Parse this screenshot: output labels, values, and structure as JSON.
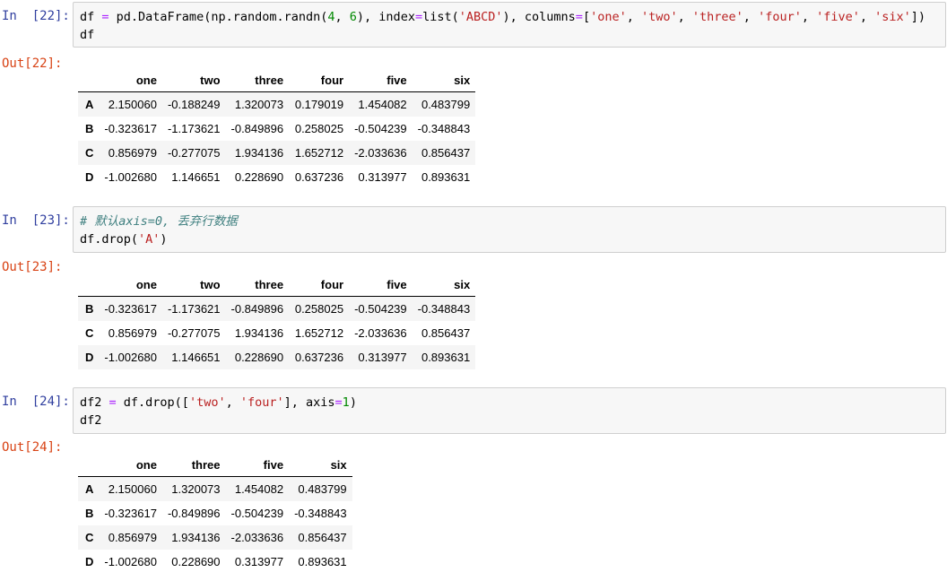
{
  "cells": [
    {
      "in_prompt": "In  [22]:",
      "code_lines": [
        [
          {
            "t": "df ",
            "k": ""
          },
          {
            "t": "=",
            "k": "o"
          },
          {
            "t": " pd.DataFrame(np.random.randn(",
            "k": ""
          },
          {
            "t": "4",
            "k": "n"
          },
          {
            "t": ", ",
            "k": ""
          },
          {
            "t": "6",
            "k": "n"
          },
          {
            "t": "), index",
            "k": ""
          },
          {
            "t": "=",
            "k": "o"
          },
          {
            "t": "list(",
            "k": ""
          },
          {
            "t": "'ABCD'",
            "k": "s"
          },
          {
            "t": "), columns",
            "k": ""
          },
          {
            "t": "=",
            "k": "o"
          },
          {
            "t": "[",
            "k": ""
          },
          {
            "t": "'one'",
            "k": "s"
          },
          {
            "t": ", ",
            "k": ""
          },
          {
            "t": "'two'",
            "k": "s"
          },
          {
            "t": ", ",
            "k": ""
          },
          {
            "t": "'three'",
            "k": "s"
          },
          {
            "t": ", ",
            "k": ""
          },
          {
            "t": "'four'",
            "k": "s"
          },
          {
            "t": ", ",
            "k": ""
          },
          {
            "t": "'five'",
            "k": "s"
          },
          {
            "t": ", ",
            "k": ""
          },
          {
            "t": "'six'",
            "k": "s"
          },
          {
            "t": "])",
            "k": ""
          }
        ],
        [
          {
            "t": "df",
            "k": ""
          }
        ]
      ],
      "out_prompt": "Out[22]:",
      "table": {
        "columns": [
          "one",
          "two",
          "three",
          "four",
          "five",
          "six"
        ],
        "rows": [
          {
            "index": "A",
            "values": [
              "2.150060",
              "-0.188249",
              "1.320073",
              "0.179019",
              "1.454082",
              "0.483799"
            ]
          },
          {
            "index": "B",
            "values": [
              "-0.323617",
              "-1.173621",
              "-0.849896",
              "0.258025",
              "-0.504239",
              "-0.348843"
            ]
          },
          {
            "index": "C",
            "values": [
              "0.856979",
              "-0.277075",
              "1.934136",
              "1.652712",
              "-2.033636",
              "0.856437"
            ]
          },
          {
            "index": "D",
            "values": [
              "-1.002680",
              "1.146651",
              "0.228690",
              "0.637236",
              "0.313977",
              "0.893631"
            ]
          }
        ]
      }
    },
    {
      "in_prompt": "In  [23]:",
      "code_lines": [
        [
          {
            "t": "# 默认axis=0, 丢弃行数据",
            "k": "c"
          }
        ],
        [
          {
            "t": "df.drop(",
            "k": ""
          },
          {
            "t": "'A'",
            "k": "s"
          },
          {
            "t": ")",
            "k": ""
          }
        ]
      ],
      "out_prompt": "Out[23]:",
      "table": {
        "columns": [
          "one",
          "two",
          "three",
          "four",
          "five",
          "six"
        ],
        "rows": [
          {
            "index": "B",
            "values": [
              "-0.323617",
              "-1.173621",
              "-0.849896",
              "0.258025",
              "-0.504239",
              "-0.348843"
            ]
          },
          {
            "index": "C",
            "values": [
              "0.856979",
              "-0.277075",
              "1.934136",
              "1.652712",
              "-2.033636",
              "0.856437"
            ]
          },
          {
            "index": "D",
            "values": [
              "-1.002680",
              "1.146651",
              "0.228690",
              "0.637236",
              "0.313977",
              "0.893631"
            ]
          }
        ]
      }
    },
    {
      "in_prompt": "In  [24]:",
      "code_lines": [
        [
          {
            "t": "df2 ",
            "k": ""
          },
          {
            "t": "=",
            "k": "o"
          },
          {
            "t": " df.drop([",
            "k": ""
          },
          {
            "t": "'two'",
            "k": "s"
          },
          {
            "t": ", ",
            "k": ""
          },
          {
            "t": "'four'",
            "k": "s"
          },
          {
            "t": "], axis",
            "k": ""
          },
          {
            "t": "=",
            "k": "o"
          },
          {
            "t": "1",
            "k": "n"
          },
          {
            "t": ")",
            "k": ""
          }
        ],
        [
          {
            "t": "df2",
            "k": ""
          }
        ]
      ],
      "out_prompt": "Out[24]:",
      "table": {
        "columns": [
          "one",
          "three",
          "five",
          "six"
        ],
        "rows": [
          {
            "index": "A",
            "values": [
              "2.150060",
              "1.320073",
              "1.454082",
              "0.483799"
            ]
          },
          {
            "index": "B",
            "values": [
              "-0.323617",
              "-0.849896",
              "-0.504239",
              "-0.348843"
            ]
          },
          {
            "index": "C",
            "values": [
              "0.856979",
              "1.934136",
              "-2.033636",
              "0.856437"
            ]
          },
          {
            "index": "D",
            "values": [
              "-1.002680",
              "0.228690",
              "0.313977",
              "0.893631"
            ]
          }
        ]
      }
    }
  ],
  "colors": {
    "in_prompt": "#303f9f",
    "out_prompt": "#d84315",
    "string": "#ba2121",
    "number": "#008800",
    "operator": "#aa22ff",
    "comment": "#408080"
  }
}
